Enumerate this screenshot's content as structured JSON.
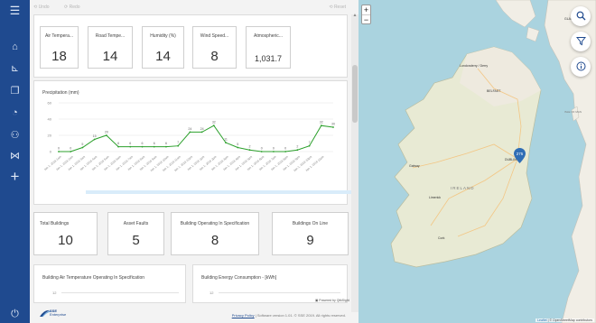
{
  "toolbar": {
    "undo": "Undo",
    "redo": "Redo",
    "reset": "Reset"
  },
  "nav": {
    "items": [
      "menu-icon",
      "home-icon",
      "chart-icon",
      "copy-icon",
      "dashboard-icon",
      "users-icon",
      "link-icon",
      "add-icon",
      "logout-icon"
    ]
  },
  "sensors": [
    {
      "label": "Air Tempera...",
      "value": "18"
    },
    {
      "label": "Road Tempe...",
      "value": "14"
    },
    {
      "label": "Humidity (%)",
      "value": "14"
    },
    {
      "label": "Wind Speed...",
      "value": "8"
    },
    {
      "label": "Atmospheric...",
      "value": "1,031.7"
    }
  ],
  "chart_data": {
    "type": "line",
    "title": "Precipitation (mm)",
    "ylim": [
      0,
      60
    ],
    "yticks": [
      0,
      20,
      40,
      60
    ],
    "x": [
      "Jan 1, 2018 1am",
      "Jan 1, 2018 2am",
      "Jan 1, 2018 3am",
      "Jan 1, 2018 4am",
      "Jan 1, 2018 5am",
      "Jan 1, 2018 6am",
      "Jan 1, 2018 7am",
      "Jan 1, 2018 8am",
      "Jan 1, 2018 9am",
      "Jan 1, 2018 10am",
      "Jan 1, 2018 11am",
      "Jan 1, 2018 12pm",
      "Jan 1, 2018 1pm",
      "Jan 1, 2018 2pm",
      "Jan 1, 2018 3pm",
      "Jan 1, 2018 4pm",
      "Jan 1, 2018 5pm",
      "Jan 1, 2018 6pm",
      "Jan 1, 2018 7pm",
      "Jan 1, 2018 8pm",
      "Jan 1, 2018 9pm",
      "Jan 1, 2018 10pm",
      "Jan 1, 2018 11pm"
    ],
    "values": [
      0,
      0,
      5,
      15,
      20,
      6,
      6,
      6,
      6,
      6,
      7,
      24,
      24,
      32,
      11,
      5,
      2,
      0,
      0,
      0,
      2,
      7,
      32,
      30
    ],
    "grid": true,
    "legend": "none",
    "color": "#2ca02c"
  },
  "kpis": [
    {
      "label": "Total Buildings",
      "value": "10"
    },
    {
      "label": "Asset Faults",
      "value": "5"
    },
    {
      "label": "Building Operating In Specification",
      "value": "8"
    },
    {
      "label": "Buildings On Line",
      "value": "9"
    }
  ],
  "mini_charts": [
    {
      "title": "Building Air Temperature Operating In Specification",
      "tick": "12"
    },
    {
      "title": "Building Energy Consumption - [kWh]",
      "tick": "12"
    }
  ],
  "footer": {
    "brand": "SSE",
    "brand_sub": "Enterprise",
    "privacy": "Privacy Policy",
    "copyright": " | Software version 1.01. © SSE 2019. All rights reserved.",
    "qlik": "Powered by QlikSight"
  },
  "map": {
    "places": {
      "glasgow": "GLAS",
      "londonderry": "Londonderry / Derry",
      "belfast": "BELFAST",
      "galway": "Galway",
      "dublin": "DUBLIN",
      "ireland": "IRELAND",
      "limerick": "Limerick",
      "cork": "Cork",
      "isle": "ISLE OF MAN"
    },
    "cluster_count": "275",
    "attribution_leaflet": "Leaflet",
    "attribution_osm": " | © OpenStreetMap contributors",
    "zoom_in": "+",
    "zoom_out": "−"
  }
}
